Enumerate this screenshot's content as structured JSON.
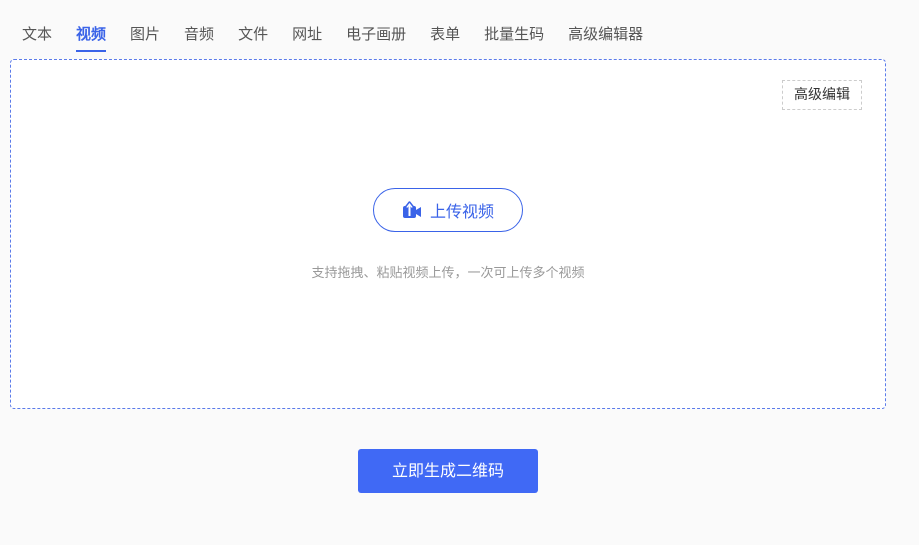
{
  "tabs": [
    {
      "label": "文本"
    },
    {
      "label": "视频"
    },
    {
      "label": "图片"
    },
    {
      "label": "音频"
    },
    {
      "label": "文件"
    },
    {
      "label": "网址"
    },
    {
      "label": "电子画册"
    },
    {
      "label": "表单"
    },
    {
      "label": "批量生码"
    },
    {
      "label": "高级编辑器"
    }
  ],
  "active_tab": "视频",
  "upload_area": {
    "advanced_edit_label": "高级编辑",
    "upload_button_label": "上传视频",
    "upload_icon": "upload-video-icon",
    "hint": "支持拖拽、粘贴视频上传，一次可上传多个视频"
  },
  "generate_button_label": "立即生成二维码",
  "colors": {
    "accent": "#3a63e8",
    "primary_button": "#4069f5",
    "hint_text": "#999999"
  }
}
